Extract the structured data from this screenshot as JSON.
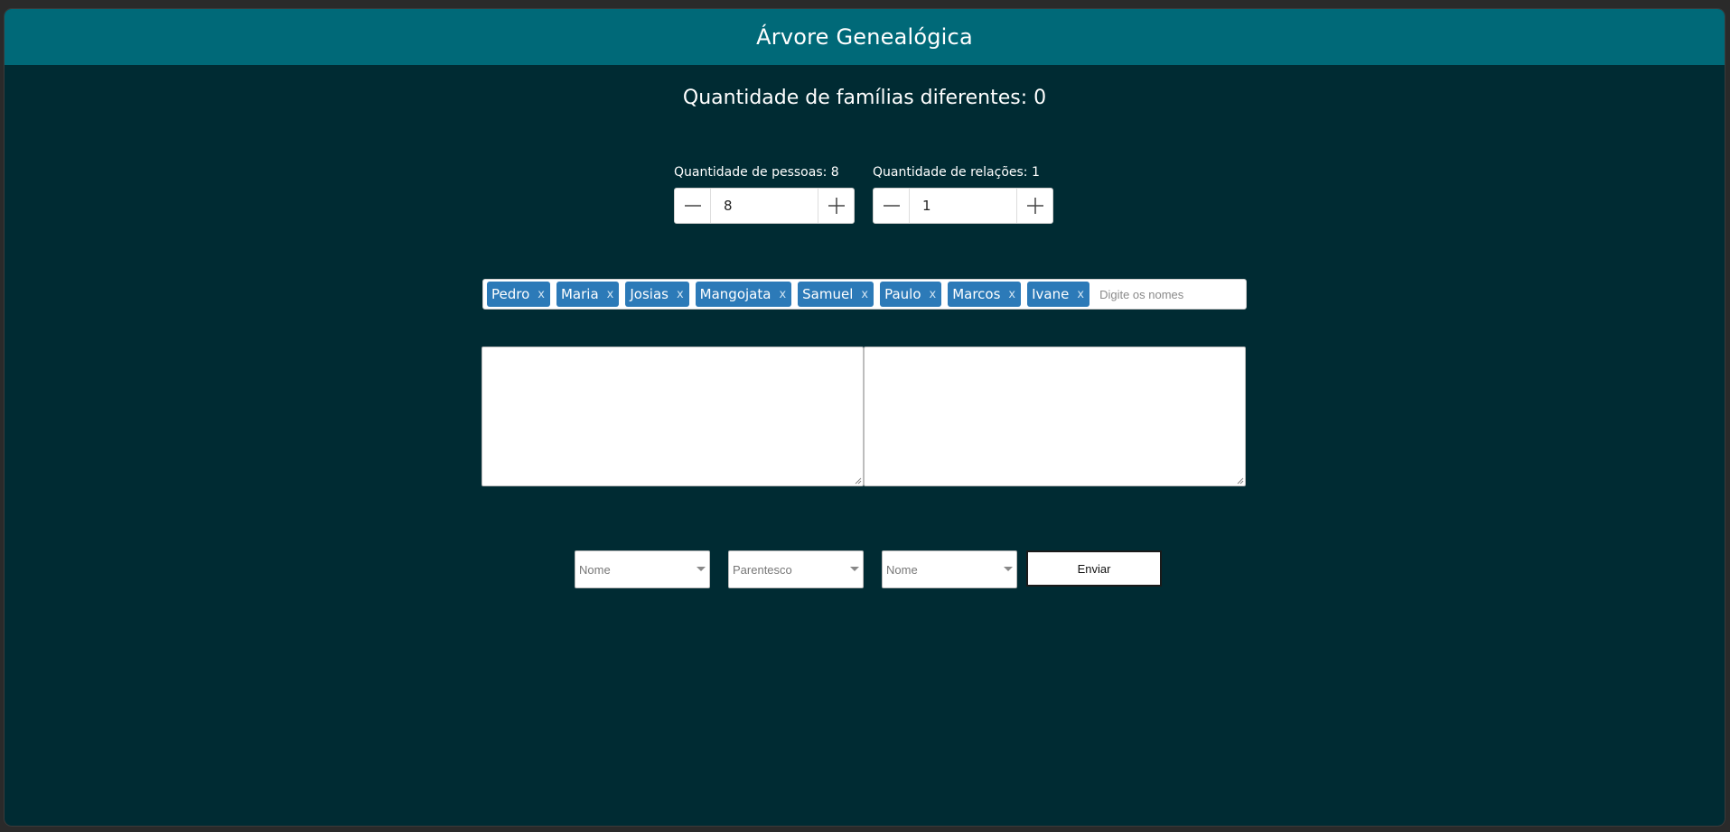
{
  "header": {
    "title": "Árvore Genealógica"
  },
  "families": {
    "label": "Quantidade de famílias diferentes:",
    "count": "0"
  },
  "people": {
    "label": "Quantidade de pessoas:",
    "count": "8",
    "value": "8"
  },
  "relations": {
    "label": "Quantidade de relações:",
    "count": "1",
    "value": "1"
  },
  "names": {
    "tags": [
      "Pedro",
      "Maria",
      "Josias",
      "Mangojata",
      "Samuel",
      "Paulo",
      "Marcos",
      "Ivane"
    ],
    "remove_glyph": "x",
    "placeholder": "Digite os nomes"
  },
  "relation_form": {
    "name1_placeholder": "Nome",
    "kinship_placeholder": "Parentesco",
    "name2_placeholder": "Nome",
    "submit_label": "Enviar"
  },
  "colors": {
    "header_bg": "#006978",
    "page_bg": "#002b33",
    "tag_bg": "#2c7ab8"
  },
  "icons": {
    "minus": "minus-icon",
    "plus": "plus-icon",
    "dropdown": "chevron-down-icon"
  }
}
